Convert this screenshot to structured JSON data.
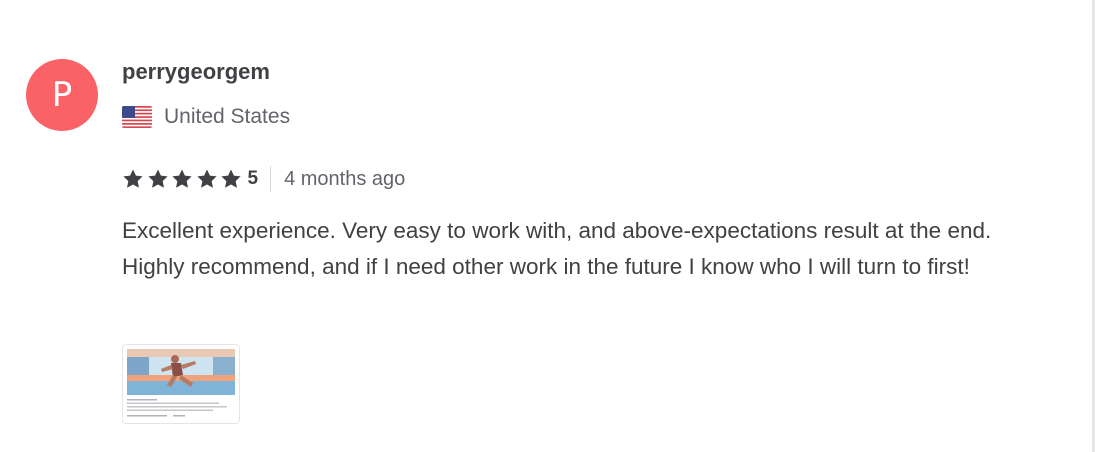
{
  "review": {
    "avatar_initial": "P",
    "avatar_color": "#fb6267",
    "username": "perrygeorgem",
    "country": {
      "flag_icon": "us-flag-icon",
      "name": "United States"
    },
    "rating": {
      "stars": 5,
      "star_icon": "star-icon",
      "value": "5"
    },
    "time_ago": "4 months ago",
    "text": "Excellent experience. Very easy to work with, and above-expectations result at the end. Highly recommend, and if I need other work in the future I know who I will turn to first!",
    "attachment": {
      "type": "image-thumbnail"
    }
  },
  "colors": {
    "text_primary": "#404145",
    "text_secondary": "#62646a",
    "star": "#404145"
  }
}
